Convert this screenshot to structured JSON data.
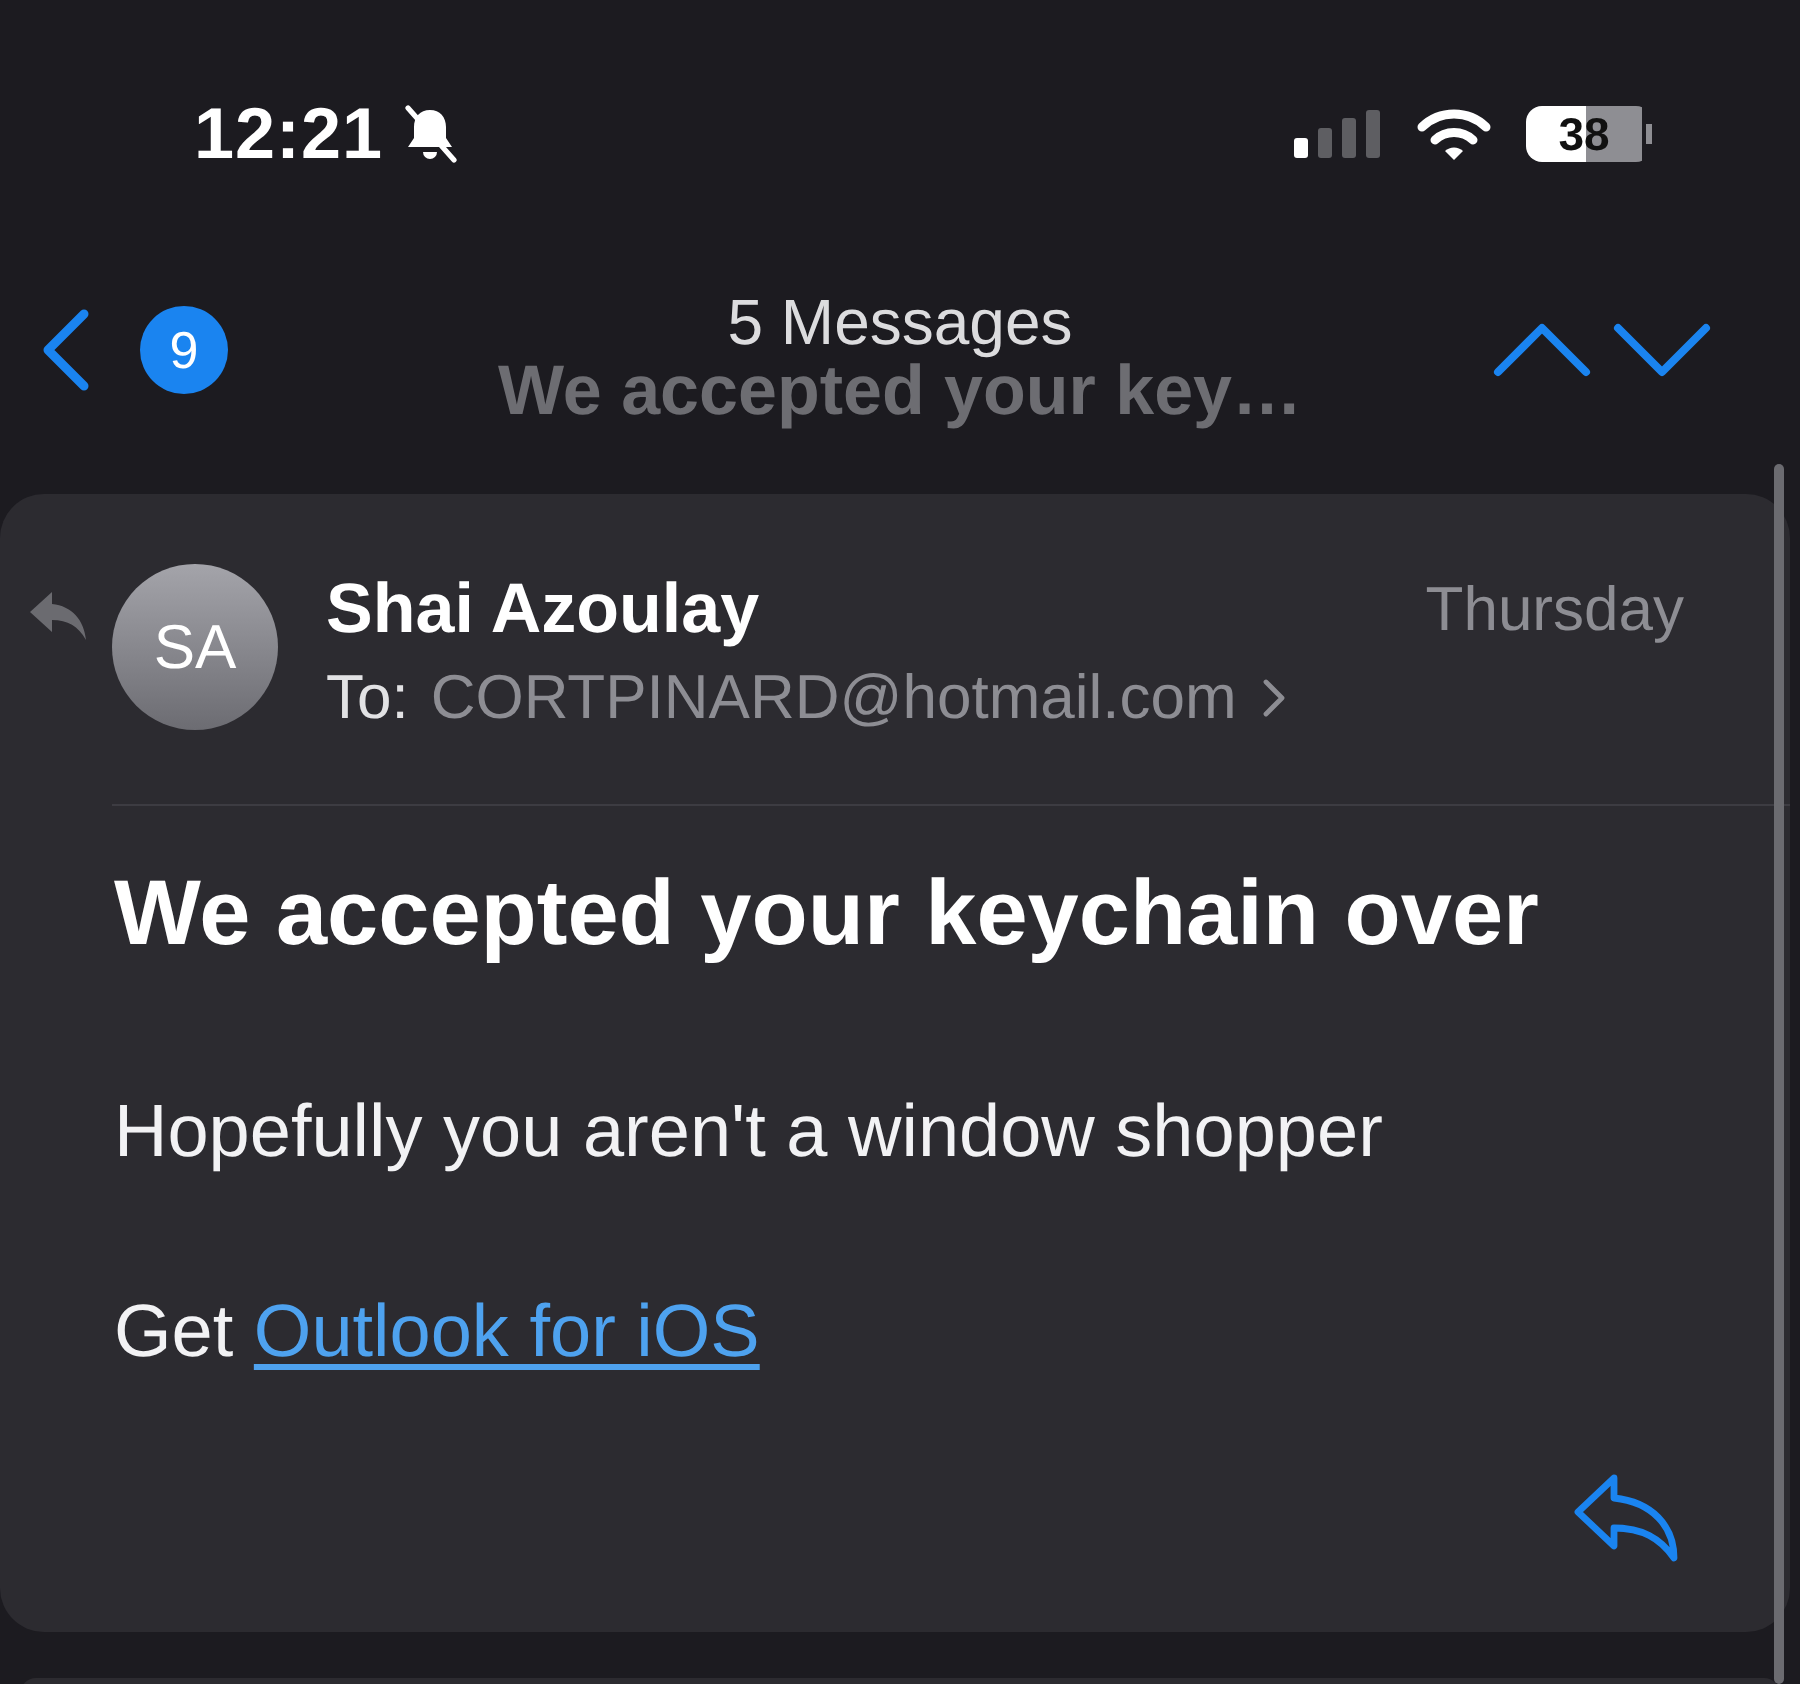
{
  "status_bar": {
    "time": "12:21",
    "battery": "38"
  },
  "nav": {
    "unread_count": "9",
    "title": "5 Messages",
    "subtitle": "We accepted your key…"
  },
  "message": {
    "avatar_initials": "SA",
    "sender": "Shai Azoulay",
    "to_label": "To:",
    "recipient": "CORTPINARD@hotmail.com",
    "date": "Thursday",
    "subject": "We accepted your keychain over",
    "body": "Hopefully you aren't a window shopper",
    "signature_prefix": "Get",
    "signature_link": "Outlook for iOS"
  }
}
